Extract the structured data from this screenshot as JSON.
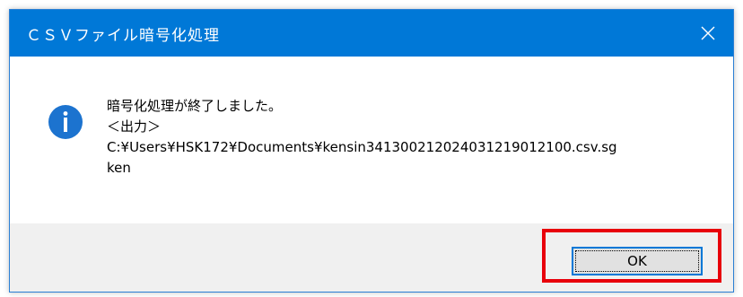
{
  "window": {
    "title": "ＣＳＶファイル暗号化処理",
    "close_icon": "close-icon"
  },
  "message": {
    "icon": "info-icon",
    "line1": "暗号化処理が終了しました。",
    "line2": "＜出力＞",
    "line3": "C:¥Users¥HSK172¥Documents¥kensin34130021202403121901210 0.csv.sg",
    "line4": "ken"
  },
  "footer": {
    "ok_label": "OK"
  },
  "colors": {
    "titlebar": "#0078d7",
    "highlight": "#e8000b"
  }
}
